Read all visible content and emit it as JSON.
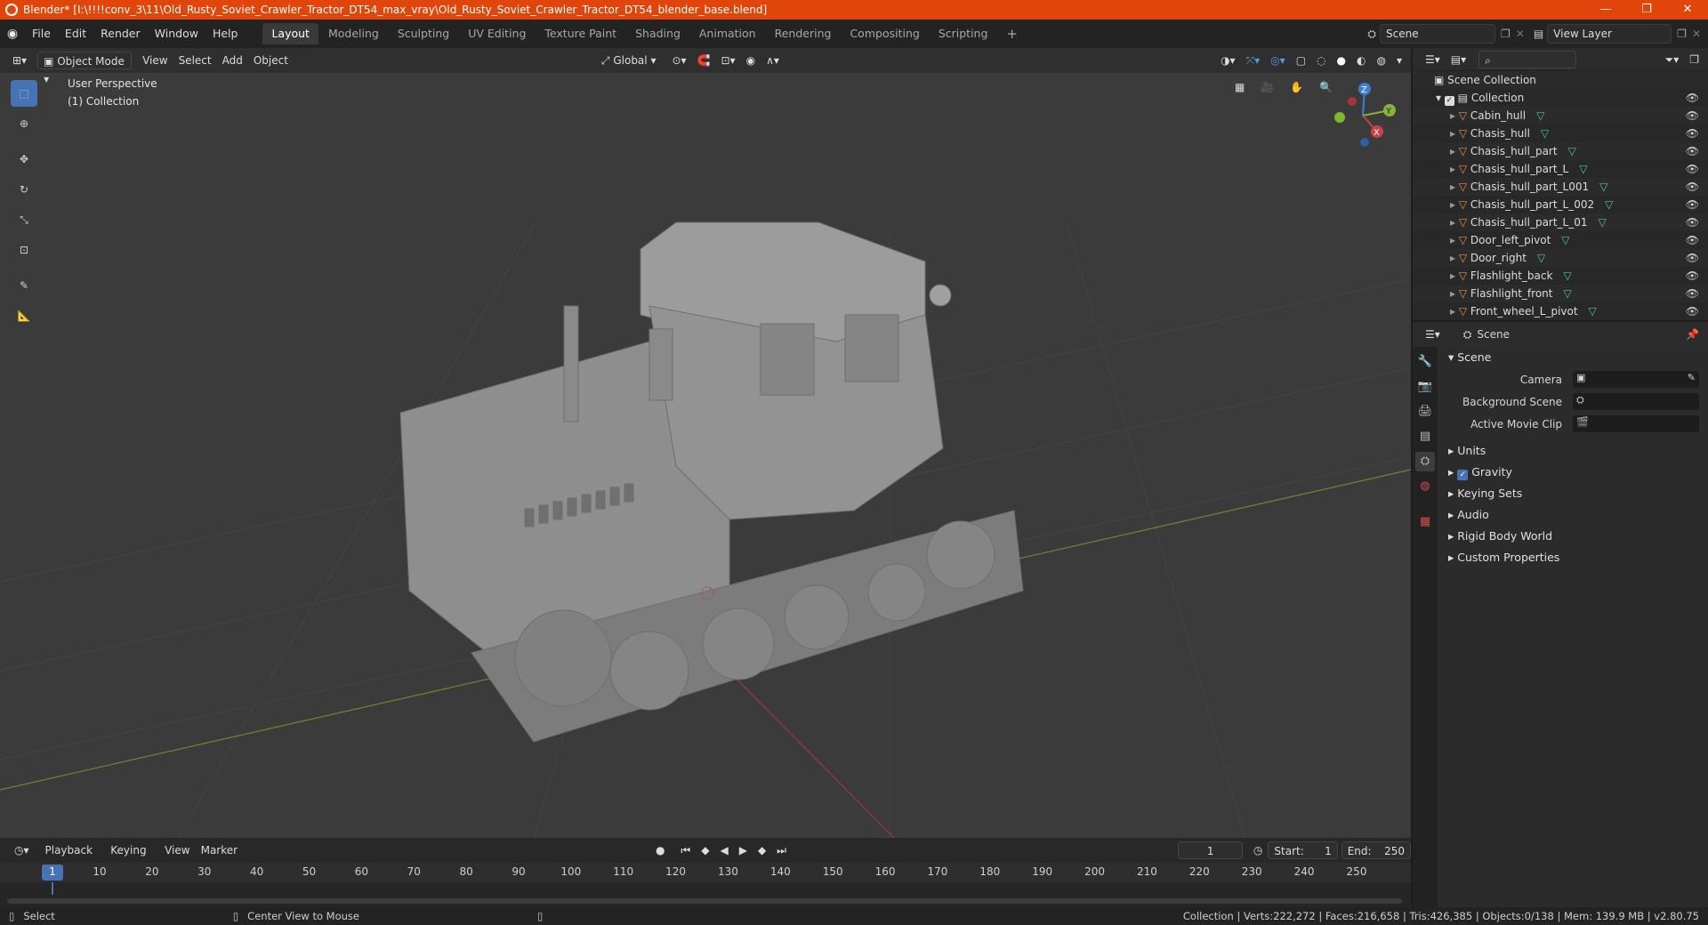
{
  "titlebar": {
    "title": "Blender* [I:\\!!!!conv_3\\11\\Old_Rusty_Soviet_Crawler_Tractor_DT54_max_vray\\Old_Rusty_Soviet_Crawler_Tractor_DT54_blender_base.blend]",
    "minimize": "—",
    "maximize": "❐",
    "close": "✕"
  },
  "menubar": {
    "items": [
      "File",
      "Edit",
      "Render",
      "Window",
      "Help"
    ],
    "workspaces": [
      "Layout",
      "Modeling",
      "Sculpting",
      "UV Editing",
      "Texture Paint",
      "Shading",
      "Animation",
      "Rendering",
      "Compositing",
      "Scripting"
    ],
    "add_tab": "+",
    "scene_label": "Scene",
    "view_layer_label": "View Layer"
  },
  "viewport": {
    "mode": "Object Mode",
    "menus": [
      "View",
      "Select",
      "Add",
      "Object"
    ],
    "transform_orientation": "Global",
    "perspective": "User Perspective",
    "collection": "(1) Collection",
    "gizmo": {
      "x": "X",
      "y": "Y",
      "z": "Z"
    }
  },
  "timeline": {
    "menus": [
      "Playback",
      "Keying",
      "View",
      "Marker"
    ],
    "current_frame": "1",
    "start_label": "Start:",
    "start": "1",
    "end_label": "End:",
    "end": "250",
    "ticks": [
      "1",
      "10",
      "20",
      "30",
      "40",
      "50",
      "60",
      "70",
      "80",
      "90",
      "100",
      "110",
      "120",
      "130",
      "140",
      "150",
      "160",
      "170",
      "180",
      "190",
      "200",
      "210",
      "220",
      "230",
      "240",
      "250"
    ]
  },
  "statusbar": {
    "select": "Select",
    "center_view": "Center View to Mouse",
    "stats": "Collection | Verts:222,272 | Faces:216,658 | Tris:426,385 | Objects:0/138 | Mem: 139.9 MB | v2.80.75"
  },
  "outliner": {
    "scene_collection": "Scene Collection",
    "collection": "Collection",
    "items": [
      "Cabin_hull",
      "Chasis_hull",
      "Chasis_hull_part",
      "Chasis_hull_part_L",
      "Chasis_hull_part_L001",
      "Chasis_hull_part_L_002",
      "Chasis_hull_part_L_01",
      "Door_left_pivot",
      "Door_right",
      "Flashlight_back",
      "Flashlight_front",
      "Front_wheel_L_pivot"
    ]
  },
  "properties": {
    "header": "Scene",
    "panel_title": "Scene",
    "fields": [
      {
        "label": "Camera"
      },
      {
        "label": "Background Scene"
      },
      {
        "label": "Active Movie Clip"
      }
    ],
    "sections": [
      "Units",
      "Gravity",
      "Keying Sets",
      "Audio",
      "Rigid Body World",
      "Custom Properties"
    ]
  },
  "colors": {
    "titlebar": "#e0460b",
    "accent": "#4772b3",
    "axis_x": "#c8404a",
    "axis_y": "#8ab33a",
    "axis_z": "#3d7ed8",
    "object_icon": "#e8933d",
    "mesh_icon": "#4fc1a6"
  }
}
